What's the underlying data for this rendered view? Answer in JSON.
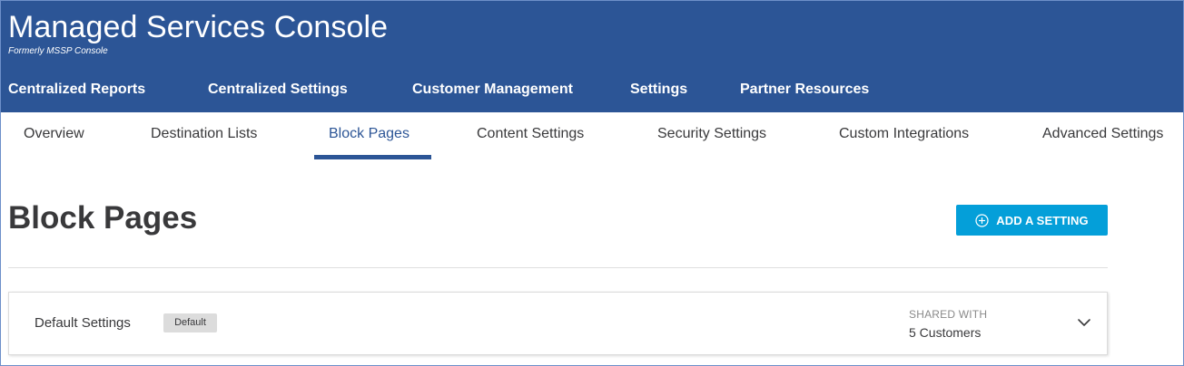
{
  "app": {
    "title": "Managed Services Console",
    "subtitle": "Formerly MSSP Console"
  },
  "top_nav": {
    "items": [
      {
        "label": "Centralized Reports",
        "active": false
      },
      {
        "label": "Centralized Settings",
        "active": true
      },
      {
        "label": "Customer Management",
        "active": false
      },
      {
        "label": "Settings",
        "active": false
      },
      {
        "label": "Partner Resources",
        "active": false
      }
    ]
  },
  "sub_nav": {
    "items": [
      {
        "label": "Overview",
        "active": false
      },
      {
        "label": "Destination Lists",
        "active": false
      },
      {
        "label": "Block Pages",
        "active": true
      },
      {
        "label": "Content Settings",
        "active": false
      },
      {
        "label": "Security Settings",
        "active": false
      },
      {
        "label": "Custom Integrations",
        "active": false
      },
      {
        "label": "Advanced Settings",
        "active": false
      }
    ]
  },
  "page": {
    "title": "Block Pages",
    "add_button_label": "ADD A SETTING",
    "add_button_icon": "plus-circle-icon"
  },
  "settings": [
    {
      "name": "Default Settings",
      "badge": "Default",
      "shared_label": "SHARED WITH",
      "shared_value": "5 Customers",
      "expand_icon": "chevron-down-icon"
    }
  ],
  "colors": {
    "header_bg": "#2c5596",
    "accent": "#049fd9",
    "active_tab": "#2c5596",
    "text": "#39393b"
  }
}
